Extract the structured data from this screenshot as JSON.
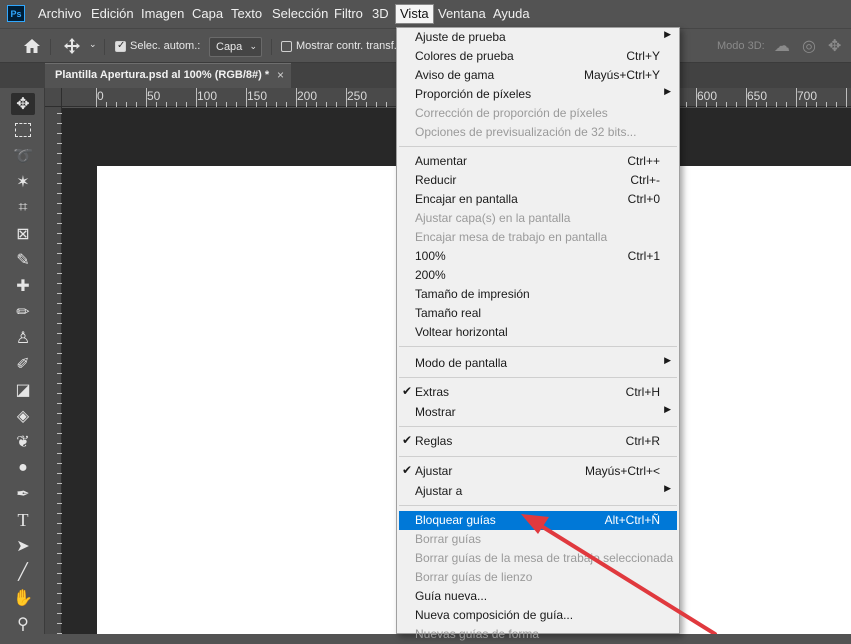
{
  "menubar": {
    "logo": "Ps",
    "items": [
      "Archivo",
      "Edición",
      "Imagen",
      "Capa",
      "Texto",
      "Selección",
      "Filtro",
      "3D",
      "Vista",
      "Ventana",
      "Ayuda"
    ],
    "active": "Vista"
  },
  "options_bar": {
    "auto_select_label": "Selec. autom.:",
    "auto_select_target": "Capa",
    "show_transform_label": "Mostrar contr. transf.",
    "mode_3d_label": "Modo 3D:"
  },
  "document_tab": {
    "title": "Plantilla Apertura.psd al 100% (RGB/8#) *",
    "close": "×"
  },
  "ruler": {
    "labels": [
      "0",
      "50",
      "100",
      "150",
      "200",
      "250",
      "600",
      "650",
      "700"
    ]
  },
  "view_menu": {
    "items": [
      {
        "label": "Ajuste de prueba",
        "shortcut": "",
        "submenu": true
      },
      {
        "label": "Colores de prueba",
        "shortcut": "Ctrl+Y"
      },
      {
        "label": "Aviso de gama",
        "shortcut": "Mayús+Ctrl+Y"
      },
      {
        "label": "Proporción de píxeles",
        "shortcut": "",
        "submenu": true
      },
      {
        "label": "Corrección de proporción de píxeles",
        "shortcut": "",
        "disabled": true
      },
      {
        "label": "Opciones de previsualización de 32 bits...",
        "shortcut": "",
        "disabled": true
      },
      {
        "label": "Aumentar",
        "shortcut": "Ctrl++"
      },
      {
        "label": "Reducir",
        "shortcut": "Ctrl+-"
      },
      {
        "label": "Encajar en pantalla",
        "shortcut": "Ctrl+0"
      },
      {
        "label": "Ajustar capa(s) en la pantalla",
        "shortcut": "",
        "disabled": true
      },
      {
        "label": "Encajar mesa de trabajo en pantalla",
        "shortcut": "",
        "disabled": true
      },
      {
        "label": "100%",
        "shortcut": "Ctrl+1"
      },
      {
        "label": "200%",
        "shortcut": ""
      },
      {
        "label": "Tamaño de impresión",
        "shortcut": ""
      },
      {
        "label": "Tamaño real",
        "shortcut": ""
      },
      {
        "label": "Voltear horizontal",
        "shortcut": ""
      },
      {
        "label": "Modo de pantalla",
        "shortcut": "",
        "submenu": true
      },
      {
        "label": "Extras",
        "shortcut": "Ctrl+H",
        "checked": true
      },
      {
        "label": "Mostrar",
        "shortcut": "",
        "submenu": true
      },
      {
        "label": "Reglas",
        "shortcut": "Ctrl+R",
        "checked": true
      },
      {
        "label": "Ajustar",
        "shortcut": "Mayús+Ctrl+<",
        "checked": true
      },
      {
        "label": "Ajustar a",
        "shortcut": "",
        "submenu": true
      },
      {
        "label": "Bloquear guías",
        "shortcut": "Alt+Ctrl+Ñ",
        "highlighted": true
      },
      {
        "label": "Borrar guías",
        "shortcut": "",
        "disabled": true
      },
      {
        "label": "Borrar guías de la mesa de trabajo seleccionada",
        "shortcut": "",
        "disabled": true
      },
      {
        "label": "Borrar guías de lienzo",
        "shortcut": "",
        "disabled": true
      },
      {
        "label": "Guía nueva...",
        "shortcut": ""
      },
      {
        "label": "Nueva composición de guía...",
        "shortcut": ""
      },
      {
        "label": "Nuevas guías de forma",
        "shortcut": "",
        "disabled": true
      }
    ]
  },
  "annotation": {
    "arrow_color": "#e0393e"
  },
  "colors": {
    "highlight": "#0078d7",
    "app_bg": "#535353",
    "menu_bg": "#f0f0f0"
  }
}
